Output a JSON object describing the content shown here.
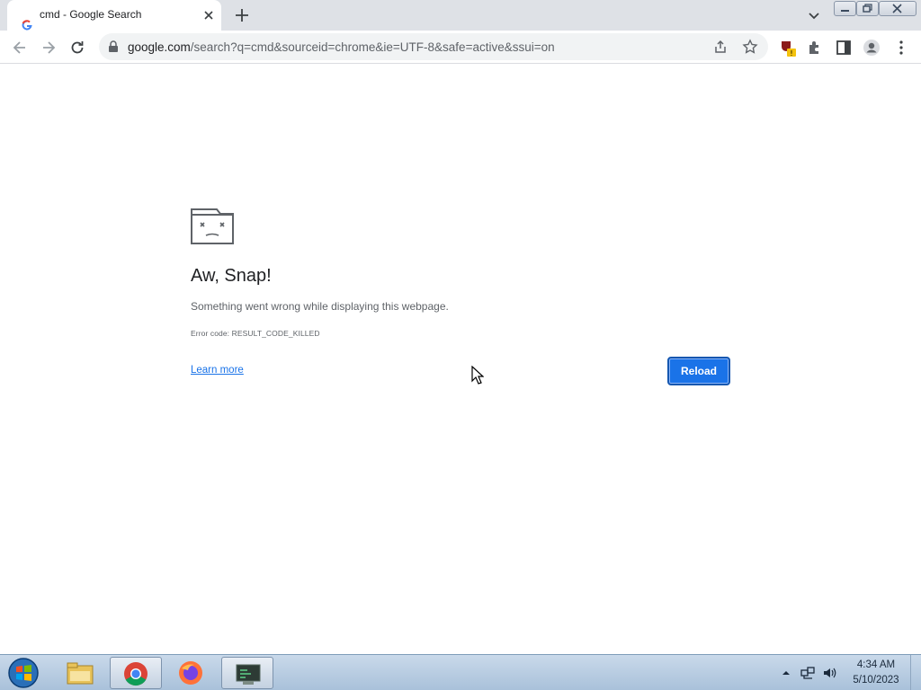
{
  "browser": {
    "tab": {
      "title": "cmd - Google Search",
      "favicon": "google-icon"
    },
    "url": {
      "domain": "google.com",
      "path": "/search?q=cmd&sourceid=chrome&ie=UTF-8&safe=active&ssui=on"
    },
    "toolbar_icons": [
      "back-icon",
      "forward-icon",
      "reload-icon",
      "lock-icon",
      "share-icon",
      "star-icon",
      "extension-badge-icon",
      "puzzle-icon",
      "side-panel-icon",
      "profile-icon",
      "more-icon"
    ]
  },
  "error_page": {
    "title": "Aw, Snap!",
    "message": "Something went wrong while displaying this webpage.",
    "error_code": "Error code: RESULT_CODE_KILLED",
    "learn_more": "Learn more",
    "reload_label": "Reload"
  },
  "taskbar": {
    "apps": [
      "file-explorer-icon",
      "chrome-icon",
      "firefox-icon",
      "terminal-app-icon"
    ],
    "clock_time": "4:34 AM",
    "clock_date": "5/10/2023"
  },
  "colors": {
    "accent": "#1a73e8",
    "tabstrip": "#dee1e6",
    "taskbar": "#b7cbe0"
  }
}
